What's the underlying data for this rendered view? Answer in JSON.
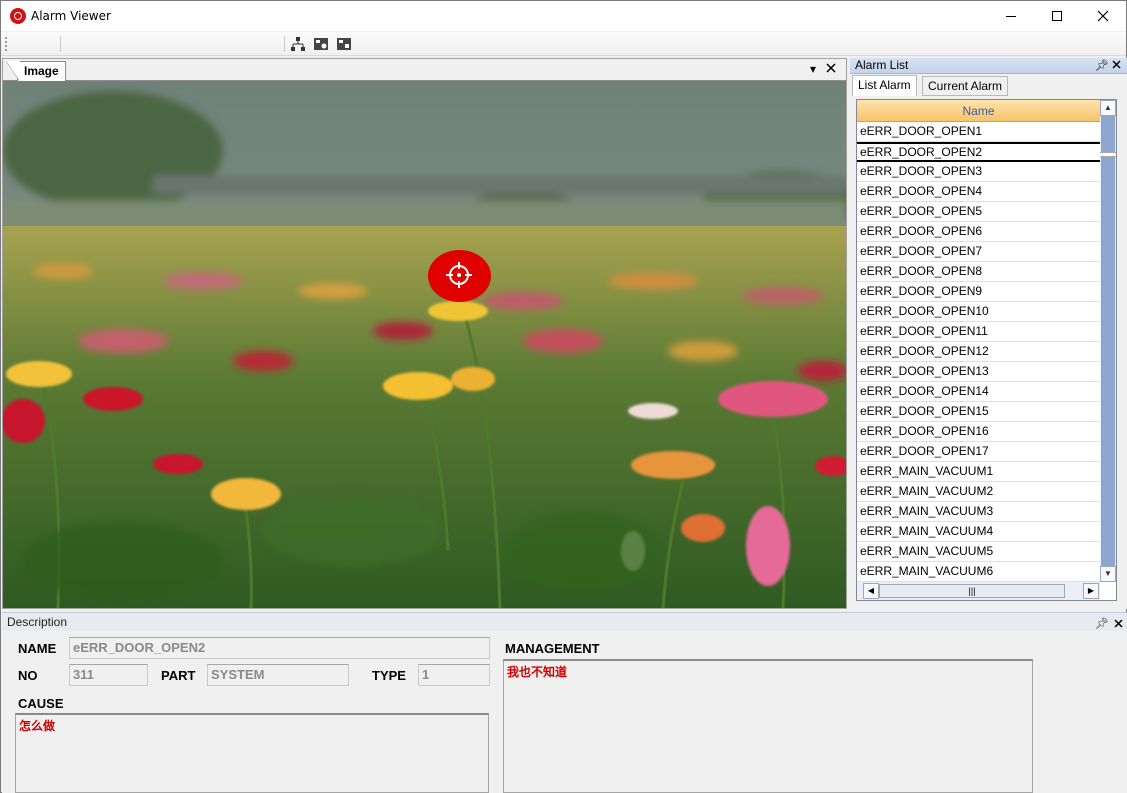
{
  "window": {
    "title": "Alarm Viewer"
  },
  "image_panel": {
    "tab_label": "Image",
    "marker": "crosshair-icon"
  },
  "alarm_list": {
    "title": "Alarm List",
    "tabs": [
      "List Alarm",
      "Current Alarm"
    ],
    "column_header": "Name",
    "selected": "eERR_DOOR_OPEN2",
    "items": [
      "eERR_DOOR_OPEN1",
      "eERR_DOOR_OPEN2",
      "eERR_DOOR_OPEN3",
      "eERR_DOOR_OPEN4",
      "eERR_DOOR_OPEN5",
      "eERR_DOOR_OPEN6",
      "eERR_DOOR_OPEN7",
      "eERR_DOOR_OPEN8",
      "eERR_DOOR_OPEN9",
      "eERR_DOOR_OPEN10",
      "eERR_DOOR_OPEN11",
      "eERR_DOOR_OPEN12",
      "eERR_DOOR_OPEN13",
      "eERR_DOOR_OPEN14",
      "eERR_DOOR_OPEN15",
      "eERR_DOOR_OPEN16",
      "eERR_DOOR_OPEN17",
      "eERR_MAIN_VACUUM1",
      "eERR_MAIN_VACUUM2",
      "eERR_MAIN_VACUUM3",
      "eERR_MAIN_VACUUM4",
      "eERR_MAIN_VACUUM5",
      "eERR_MAIN_VACUUM6"
    ]
  },
  "description": {
    "title": "Description",
    "labels": {
      "name": "NAME",
      "no": "NO",
      "part": "PART",
      "type": "TYPE",
      "cause": "CAUSE",
      "management": "MANAGEMENT"
    },
    "values": {
      "name": "eERR_DOOR_OPEN2",
      "no": "311",
      "part": "SYSTEM",
      "type": "1",
      "cause": "怎么做",
      "management": "我也不知道"
    }
  },
  "colors": {
    "marker": "#e00000",
    "list_header": "#f7c46a",
    "panel_title": "#c4d4ea",
    "text_highlight": "#d00000"
  }
}
